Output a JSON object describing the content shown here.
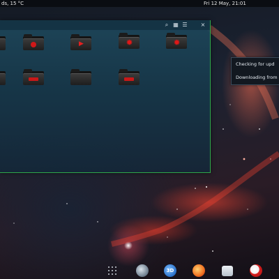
{
  "top_panel": {
    "weather": "ds, 15 °C",
    "datetime": "Fri 12 May, 21:01"
  },
  "window": {
    "toolbar_icons": [
      "search-icon",
      "grid-view-icon",
      "list-view-icon",
      "close-icon"
    ],
    "folders": [
      {
        "emblem": "partial",
        "row": 1
      },
      {
        "emblem": "circle",
        "row": 1
      },
      {
        "emblem": "play",
        "row": 1
      },
      {
        "emblem": "gear",
        "row": 1
      },
      {
        "emblem": "gear",
        "row": 1
      },
      {
        "emblem": "partial",
        "row": 2
      },
      {
        "emblem": "bar",
        "row": 2
      },
      {
        "emblem": "plain",
        "row": 2
      },
      {
        "emblem": "bar",
        "row": 2
      }
    ],
    "accent_color": "#2fa84a"
  },
  "notifications": {
    "line1": "Checking for upd",
    "line2": "Downloading from"
  },
  "dock": {
    "items": [
      "app-grid-icon",
      "steam-icon",
      "3d-app-icon",
      "firefox-icon",
      "file-manager-icon",
      "update-icon"
    ]
  }
}
